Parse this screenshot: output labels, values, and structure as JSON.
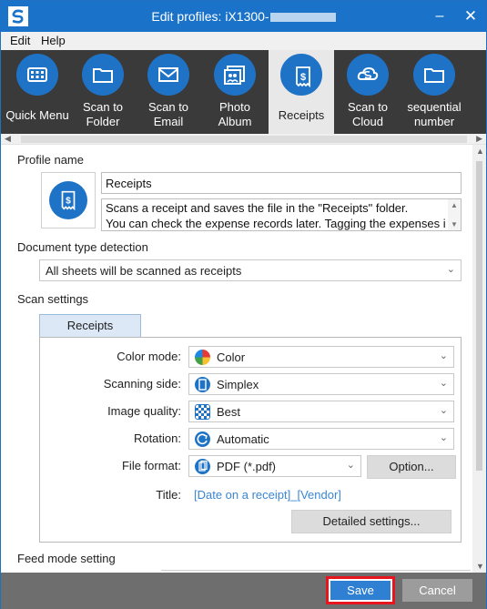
{
  "window": {
    "title_prefix": "Edit profiles: iX1300-",
    "minimize_glyph": "–",
    "close_glyph": "✕"
  },
  "menu": {
    "items": [
      "Edit",
      "Help"
    ]
  },
  "profiles": [
    {
      "label": "Quick Menu",
      "icon": "grid-icon"
    },
    {
      "label": "Scan to\nFolder",
      "icon": "folder-icon"
    },
    {
      "label": "Scan to\nEmail",
      "icon": "envelope-icon"
    },
    {
      "label": "Photo\nAlbum",
      "icon": "photo-album-icon"
    },
    {
      "label": "Receipts",
      "icon": "receipt-icon",
      "selected": true
    },
    {
      "label": "Scan to\nCloud",
      "icon": "cloud-icon"
    },
    {
      "label": "sequential\nnumber",
      "icon": "folder-icon"
    }
  ],
  "profile_name": {
    "label": "Profile name",
    "value": "Receipts",
    "description_line1": "Scans a receipt and saves the file in the \"Receipts\" folder.",
    "description_line2": "You can check the expense records later. Tagging the expenses in"
  },
  "doc_type": {
    "label": "Document type detection",
    "value": "All sheets will be scanned as receipts"
  },
  "scan_settings": {
    "label": "Scan settings",
    "tab": "Receipts",
    "color_mode": {
      "label": "Color mode:",
      "value": "Color"
    },
    "scanning_side": {
      "label": "Scanning side:",
      "value": "Simplex"
    },
    "image_quality": {
      "label": "Image quality:",
      "value": "Best"
    },
    "rotation": {
      "label": "Rotation:",
      "value": "Automatic"
    },
    "file_format": {
      "label": "File format:",
      "value": "PDF (*.pdf)",
      "option_button": "Option..."
    },
    "title": {
      "label": "Title:",
      "value": "[Date on a receipt]_[Vendor]"
    },
    "detailed_button": "Detailed settings..."
  },
  "feed_mode": {
    "label": "Feed mode setting"
  },
  "footer": {
    "save": "Save",
    "cancel": "Cancel"
  },
  "colors": {
    "titlebar": "#1a73c9",
    "accent": "#1f73c6",
    "ribbon": "#3a3a3a",
    "save_highlight": "#e8141e"
  }
}
